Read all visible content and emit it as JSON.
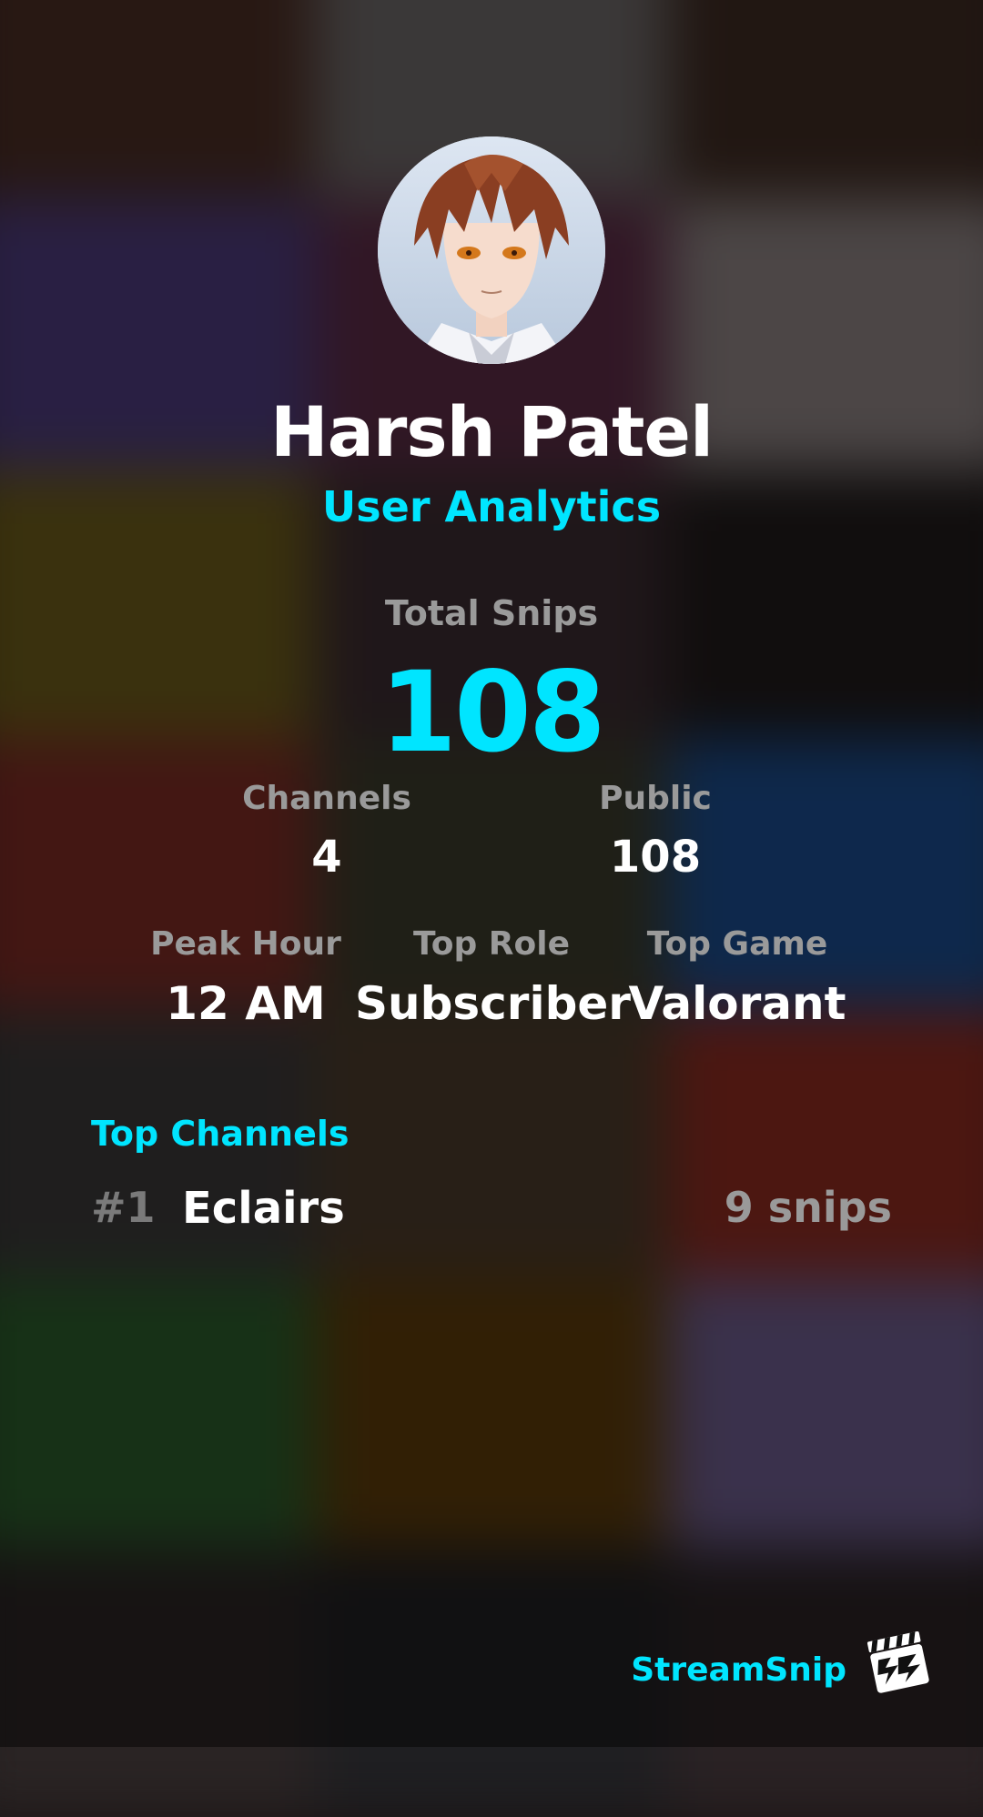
{
  "profile": {
    "name": "Harsh Patel",
    "subtitle": "User Analytics"
  },
  "stats": {
    "total_label": "Total Snips",
    "total_value": "108",
    "channels_label": "Channels",
    "channels_value": "4",
    "public_label": "Public",
    "public_value": "108",
    "peak_hour_label": "Peak Hour",
    "peak_hour_value": "12 AM",
    "top_role_label": "Top Role",
    "top_role_value": "Subscriber",
    "top_game_label": "Top Game",
    "top_game_value": "Valorant"
  },
  "top_channels": {
    "title": "Top Channels",
    "items": [
      {
        "rank": "#1",
        "name": "Eclairs",
        "count": "9 snips"
      }
    ]
  },
  "footer": {
    "brand": "StreamSnip",
    "logo_icon": "clapperboard-icon"
  },
  "colors": {
    "accent": "#00e5ff",
    "muted": "#9a9a9a",
    "text": "#ffffff"
  }
}
